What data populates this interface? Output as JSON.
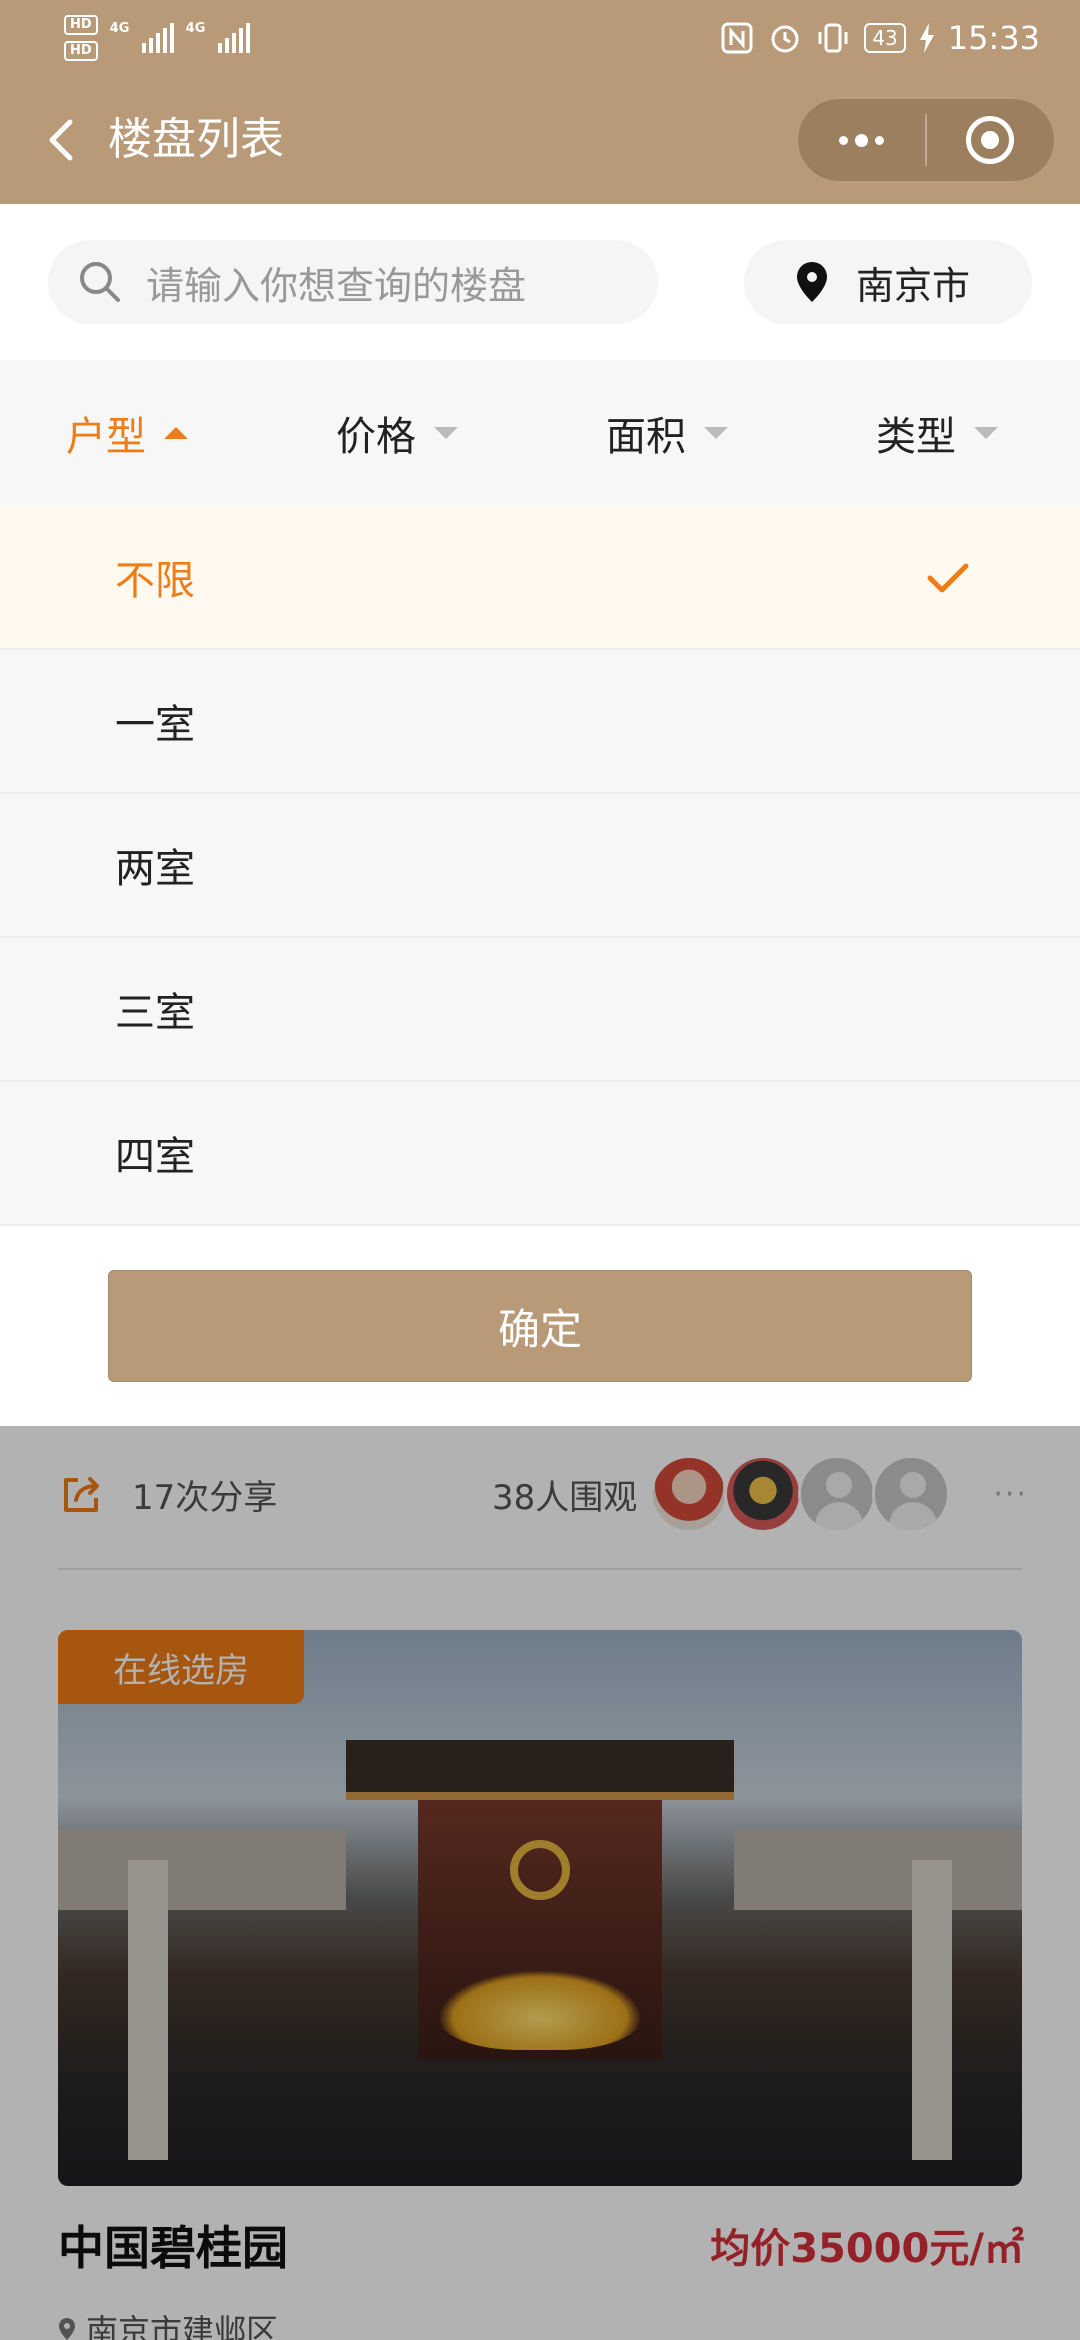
{
  "status_bar": {
    "hd1": "HD",
    "hd2": "HD",
    "sim1_net": "4G",
    "sim2_net": "4G",
    "battery": "43",
    "time": "15:33"
  },
  "nav": {
    "title": "楼盘列表",
    "back_icon": "chevron-left-icon",
    "more_icon": "more-dots-icon",
    "close_icon": "target-icon"
  },
  "search": {
    "placeholder": "请输入你想查询的楼盘",
    "city": "南京市"
  },
  "filters": [
    {
      "label": "户型",
      "active": true
    },
    {
      "label": "价格",
      "active": false
    },
    {
      "label": "面积",
      "active": false
    },
    {
      "label": "类型",
      "active": false
    }
  ],
  "room_options": [
    {
      "label": "不限",
      "selected": true
    },
    {
      "label": "一室",
      "selected": false
    },
    {
      "label": "两室",
      "selected": false
    },
    {
      "label": "三室",
      "selected": false
    },
    {
      "label": "四室",
      "selected": false
    }
  ],
  "confirm_label": "确定",
  "listing": {
    "share_count": "17次分享",
    "viewers": "38人围观",
    "more": "···",
    "badge": "在线选房",
    "name": "中国碧桂园",
    "price": "均价35000元/㎡",
    "address": "南京市建邺区"
  },
  "colors": {
    "brand": "#b89a78",
    "accent": "#f07c16",
    "price": "#d6303a"
  }
}
